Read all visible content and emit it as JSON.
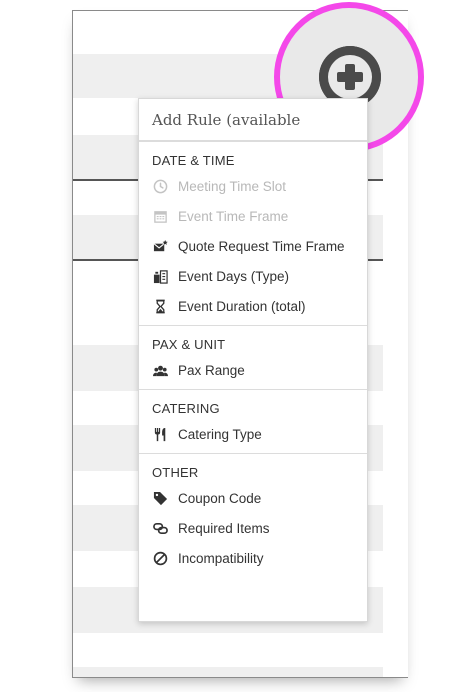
{
  "menu": {
    "header": "Add Rule (available",
    "sections": [
      {
        "title": "DATE & TIME",
        "items": [
          {
            "label": "Meeting Time Slot",
            "icon": "clock-icon",
            "disabled": true
          },
          {
            "label": "Event Time Frame",
            "icon": "calendar-icon",
            "disabled": true
          },
          {
            "label": "Quote Request Time Frame",
            "icon": "envelope-star-icon",
            "disabled": false
          },
          {
            "label": "Event Days (Type)",
            "icon": "calendar-list-icon",
            "disabled": false
          },
          {
            "label": "Event Duration (total)",
            "icon": "hourglass-icon",
            "disabled": false
          }
        ]
      },
      {
        "title": "PAX & UNIT",
        "items": [
          {
            "label": "Pax Range",
            "icon": "group-icon",
            "disabled": false
          }
        ]
      },
      {
        "title": "CATERING",
        "items": [
          {
            "label": "Catering Type",
            "icon": "cutlery-icon",
            "disabled": false
          }
        ]
      },
      {
        "title": "OTHER",
        "items": [
          {
            "label": "Coupon Code",
            "icon": "tag-icon",
            "disabled": false
          },
          {
            "label": "Required Items",
            "icon": "link-icon",
            "disabled": false
          },
          {
            "label": "Incompatibility",
            "icon": "ban-icon",
            "disabled": false
          }
        ]
      }
    ]
  },
  "colors": {
    "highlight_ring": "#f448e9",
    "text": "#333333",
    "disabled_text": "#b8b8b8"
  }
}
